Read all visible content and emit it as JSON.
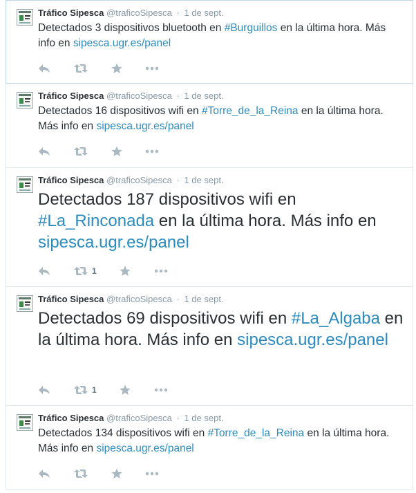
{
  "tweets": [
    {
      "name": "Tráfico Sipesca",
      "handle": "@traficoSipesca",
      "separator": "·",
      "time": "1 de sept.",
      "text_before": "Detectados 3 dispositivos bluetooth en ",
      "hashtag": "#Burguillos",
      "text_middle": " en la última hora. Más info en ",
      "link": "sipesca.ugr.es/panel",
      "text_after": "",
      "retweets": ""
    },
    {
      "name": "Tráfico Sipesca",
      "handle": "@traficoSipesca",
      "separator": "·",
      "time": "1 de sept.",
      "text_before": "Detectados 16 dispositivos wifi en ",
      "hashtag": "#Torre_de_la_Reina",
      "text_middle": " en la última hora. Más info en ",
      "link": "sipesca.ugr.es/panel",
      "text_after": "",
      "retweets": ""
    },
    {
      "name": "Tráfico Sipesca",
      "handle": "@traficoSipesca",
      "separator": "·",
      "time": "1 de sept.",
      "text_before": "Detectados 187 dispositivos wifi en ",
      "hashtag": "#La_Rinconada",
      "text_middle": " en la última hora. Más info en ",
      "link": "sipesca.ugr.es/panel",
      "text_after": "",
      "retweets": "1"
    },
    {
      "name": "Tráfico Sipesca",
      "handle": "@traficoSipesca",
      "separator": "·",
      "time": "1 de sept.",
      "text_before": "Detectados 69 dispositivos wifi en ",
      "hashtag": "#La_Algaba",
      "text_middle": " en la última hora. Más info en ",
      "link": "sipesca.ugr.es/panel",
      "text_after": "",
      "retweets": "1"
    },
    {
      "name": "Tráfico Sipesca",
      "handle": "@traficoSipesca",
      "separator": "·",
      "time": "1 de sept.",
      "text_before": "Detectados 134 dispositivos wifi en ",
      "hashtag": "#Torre_de_la_Reina",
      "text_middle": " en la última hora. Más info en ",
      "link": "sipesca.ugr.es/panel",
      "text_after": "",
      "retweets": ""
    }
  ],
  "icons": {
    "reply": "reply-icon",
    "retweet": "retweet-icon",
    "favorite": "star-icon",
    "more": "more-icon"
  },
  "colors": {
    "link": "#2b8bbf",
    "icon": "#aab8c2",
    "border": "#e1e8ed",
    "selected_border": "#bcd9ec"
  }
}
